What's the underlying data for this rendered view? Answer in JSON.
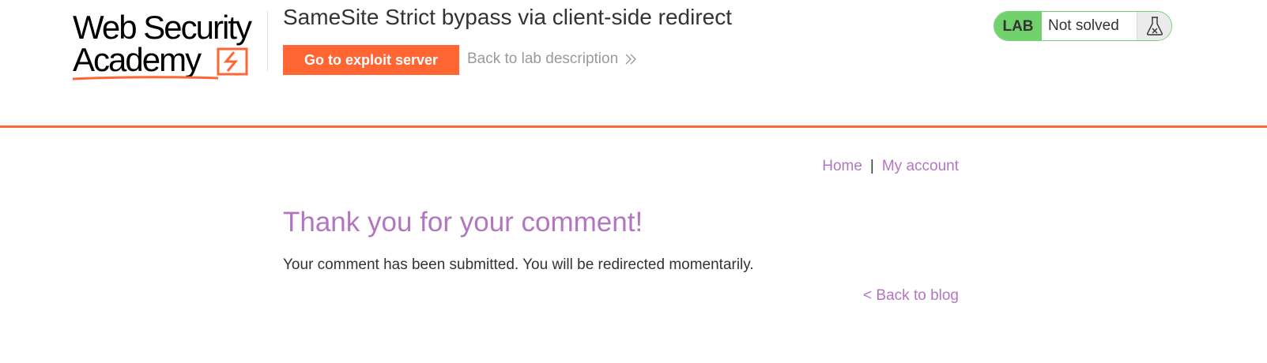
{
  "logo": {
    "line1": "Web Security",
    "line2": "Academy"
  },
  "lab": {
    "title": "SameSite Strict bypass via client-side redirect",
    "exploit_button": "Go to exploit server",
    "back_description": "Back to lab description",
    "status_label": "LAB",
    "status_text": "Not solved",
    "status_icon": "flask-icon"
  },
  "nav": {
    "home": "Home",
    "separator": "|",
    "my_account": "My account"
  },
  "main": {
    "title": "Thank you for your comment!",
    "message": "Your comment has been submitted. You will be redirected momentarily.",
    "back_link": "< Back to blog"
  },
  "colors": {
    "accent": "#ff6633",
    "link": "#b276c0",
    "status_green": "#70d16d",
    "text": "#333332"
  }
}
